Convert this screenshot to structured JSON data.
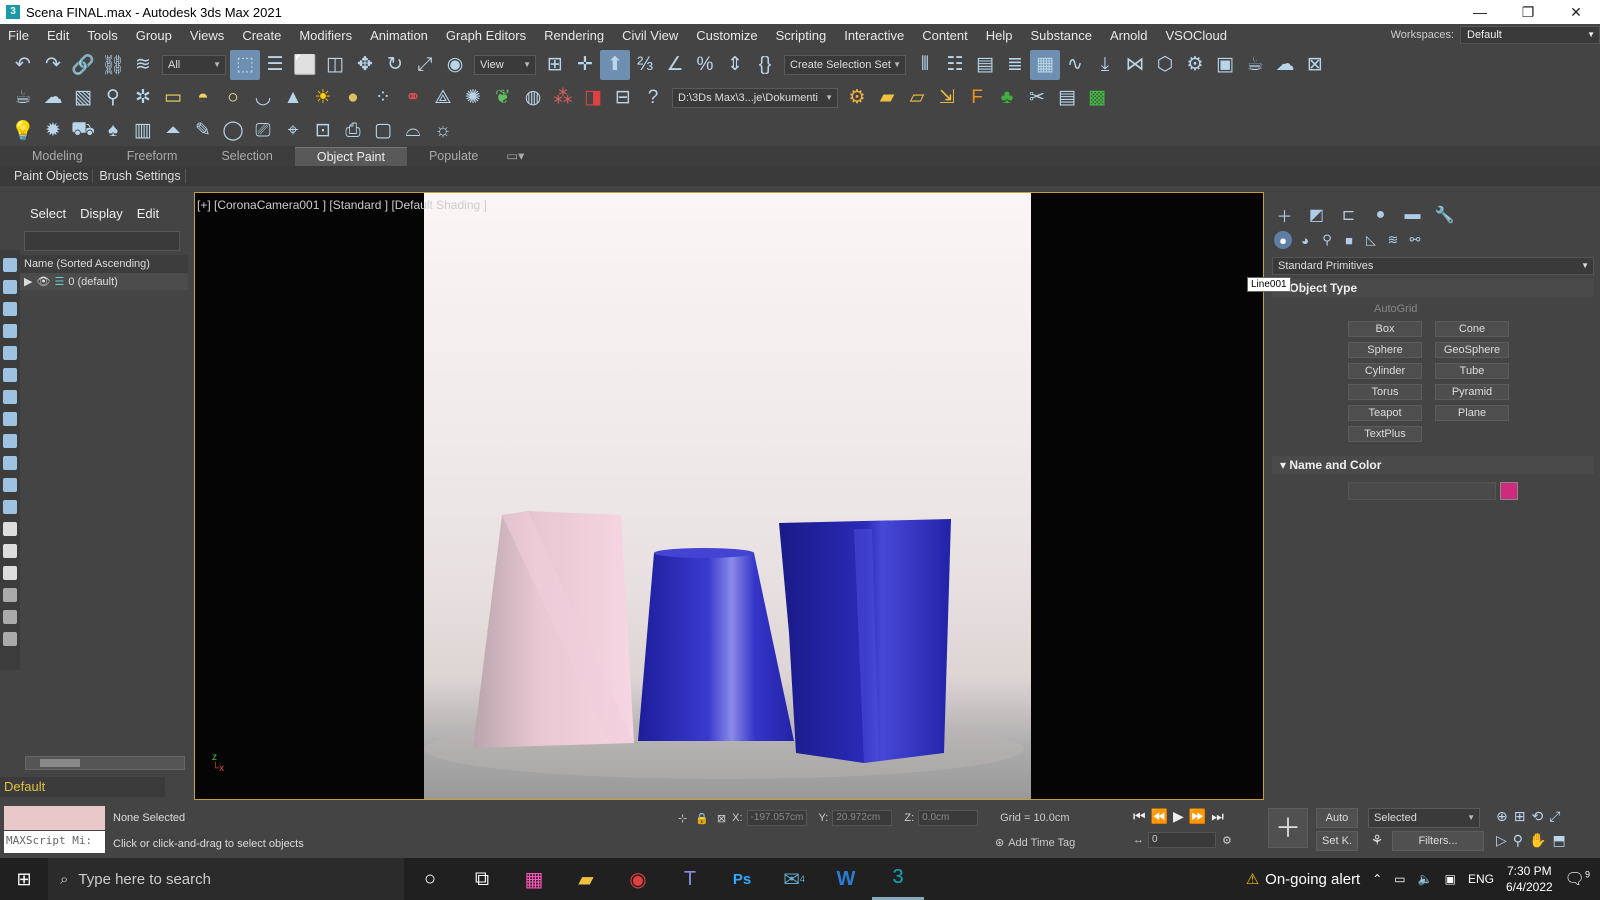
{
  "window": {
    "title": "Scena FINAL.max - Autodesk 3ds Max 2021",
    "icon": "3",
    "minimize": "—",
    "restore": "❐",
    "close": "✕"
  },
  "menu": {
    "items": [
      "File",
      "Edit",
      "Tools",
      "Group",
      "Views",
      "Create",
      "Modifiers",
      "Animation",
      "Graph Editors",
      "Rendering",
      "Civil View",
      "Customize",
      "Scripting",
      "Interactive",
      "Content",
      "Help",
      "Substance",
      "Arnold",
      "VSOCloud"
    ],
    "workspaces_label": "Workspaces:",
    "workspaces_value": "Default"
  },
  "toolbar": {
    "filter_value": "All",
    "refcoord_value": "View",
    "selection_set_value": "Create Selection Set",
    "project_path": "D:\\3Ds Max\\3...je\\Dokumenti"
  },
  "ribbon": {
    "tabs": [
      "Modeling",
      "Freeform",
      "Selection",
      "Object Paint",
      "Populate"
    ],
    "active_tab": "Object Paint",
    "sub_buttons": [
      "Paint Objects",
      "Brush Settings"
    ]
  },
  "scene_explorer": {
    "menu": [
      "Select",
      "Display",
      "Edit"
    ],
    "column_header": "Name (Sorted Ascending)",
    "layer_row": "0 (default)",
    "layer_dropdown": "Default"
  },
  "viewport": {
    "label": "[+] [CoronaCamera001 ] [Standard ] [Default Shading ]"
  },
  "command_panel": {
    "category": "Standard Primitives",
    "tooltip": "Line001",
    "object_type_title": "Object Type",
    "autogrid": "AutoGrid",
    "primitives": [
      "Box",
      "Cone",
      "Sphere",
      "GeoSphere",
      "Cylinder",
      "Tube",
      "Torus",
      "Pyramid",
      "Teapot",
      "Plane",
      "TextPlus"
    ],
    "name_color_title": "Name and Color",
    "object_color": "#d02a7c"
  },
  "status": {
    "maxscript": "MAXScript Mi:",
    "selection": "None Selected",
    "prompt": "Click or click-and-drag to select objects",
    "x_label": "X:",
    "x_value": "-197.057cm",
    "y_label": "Y:",
    "y_value": "20.972cm",
    "z_label": "Z:",
    "z_value": "0.0cm",
    "grid": "Grid = 10.0cm",
    "add_time_tag": "Add Time Tag",
    "frame": "0",
    "auto_key": "Auto",
    "set_key": "Set K.",
    "key_filter_value": "Selected",
    "filters": "Filters..."
  },
  "taskbar": {
    "search_placeholder": "Type here to search",
    "alert": "On-going alert",
    "lang": "ENG",
    "time": "7:30 PM",
    "date": "6/4/2022",
    "mail_badge": "4",
    "notif_badge": "9"
  }
}
